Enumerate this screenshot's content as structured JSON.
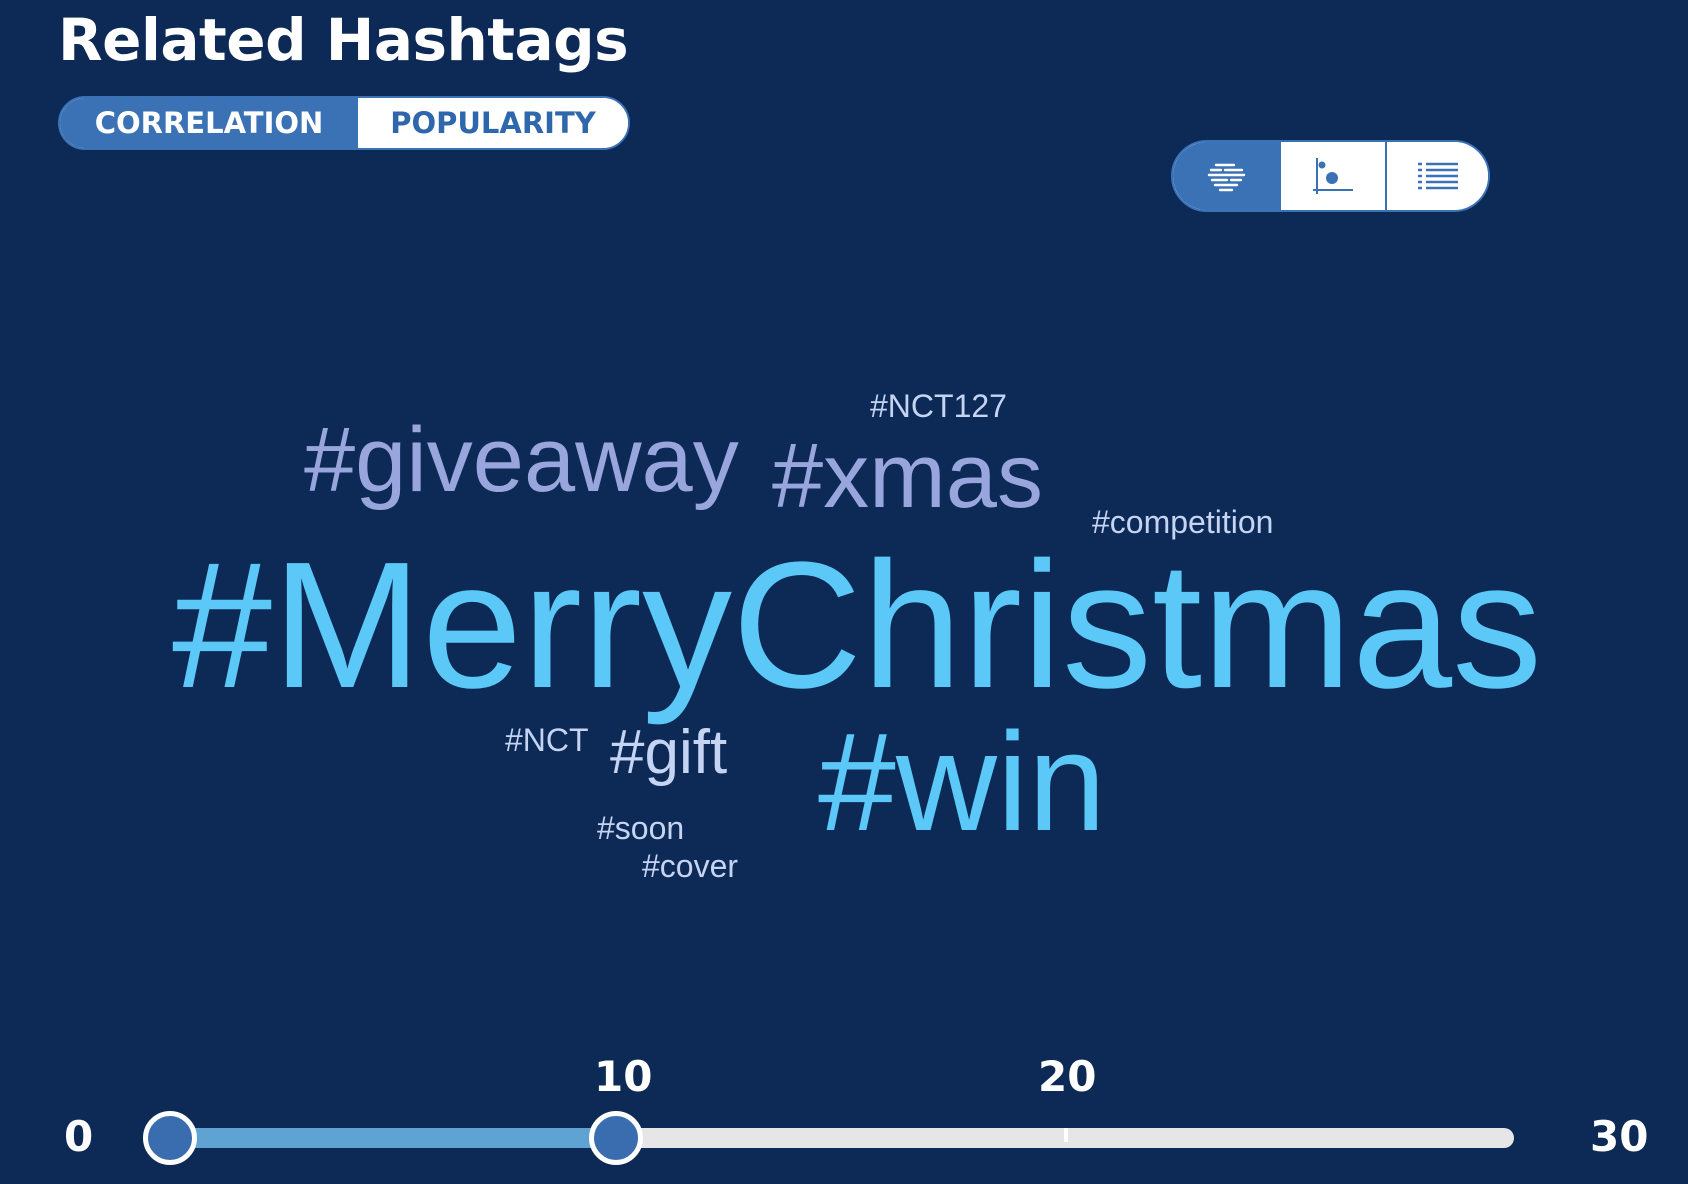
{
  "header": {
    "title": "Related Hashtags"
  },
  "sort_toggle": {
    "options": [
      {
        "label": "CORRELATION",
        "active": true
      },
      {
        "label": "POPULARITY",
        "active": false
      }
    ]
  },
  "view_switcher": {
    "options": [
      {
        "icon": "word-cloud-icon",
        "active": true
      },
      {
        "icon": "scatter-plot-icon",
        "active": false
      },
      {
        "icon": "list-view-icon",
        "active": false
      }
    ]
  },
  "word_cloud": {
    "words": [
      {
        "text": "#MerryChristmas",
        "color": "#5bc8f7"
      },
      {
        "text": "#win",
        "color": "#5bc8f7"
      },
      {
        "text": "#giveaway",
        "color": "#98a6dd"
      },
      {
        "text": "#xmas",
        "color": "#98a6dd"
      },
      {
        "text": "#gift",
        "color": "#c5d4f2"
      },
      {
        "text": "#NCT127",
        "color": "#c5d4f2"
      },
      {
        "text": "#competition",
        "color": "#c5d4f2"
      },
      {
        "text": "#NCT",
        "color": "#c5d4f2"
      },
      {
        "text": "#soon",
        "color": "#c5d4f2"
      },
      {
        "text": "#cover",
        "color": "#c5d4f2"
      }
    ]
  },
  "range_slider": {
    "min_label": "0",
    "max_label": "30",
    "value_label": "10",
    "tick_label": "20",
    "min": 0,
    "max": 30,
    "low": 0,
    "high": 10,
    "tick": 20,
    "fill_color": "#5fa3d3",
    "thumb_color": "#3a6db0"
  }
}
